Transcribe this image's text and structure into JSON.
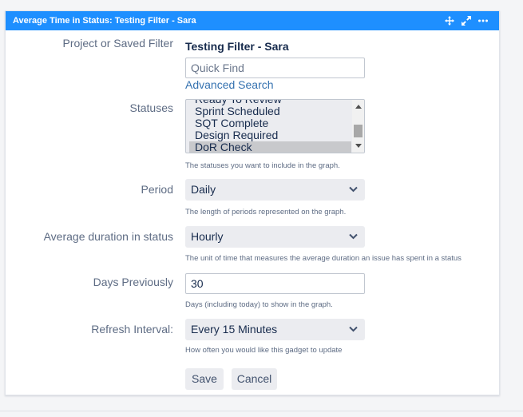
{
  "gadget": {
    "title": "Average Time in Status: Testing Filter - Sara",
    "icons": [
      "move-icon",
      "expand-icon",
      "more-icon"
    ]
  },
  "filter": {
    "label": "Project or Saved Filter",
    "value": "Testing Filter - Sara",
    "quick_find_placeholder": "Quick Find",
    "advanced_search": "Advanced Search"
  },
  "statuses": {
    "label": "Statuses",
    "options": [
      "Ready To Review",
      "Sprint Scheduled",
      "SQT Complete",
      "Design Required",
      "DoR Check"
    ],
    "selected": "DoR Check",
    "help": "The statuses you want to include in the graph."
  },
  "period": {
    "label": "Period",
    "value": "Daily",
    "help": "The length of periods represented on the graph."
  },
  "avg_duration": {
    "label": "Average duration in status",
    "value": "Hourly",
    "help": "The unit of time that measures the average duration an issue has spent in a status"
  },
  "days_previously": {
    "label": "Days Previously",
    "value": "30",
    "help": "Days (including today) to show in the graph."
  },
  "refresh": {
    "label": "Refresh Interval:",
    "value": "Every 15 Minutes",
    "help": "How often you would like this gadget to update"
  },
  "buttons": {
    "save": "Save",
    "cancel": "Cancel"
  },
  "colors": {
    "title_bar": "#1e8fff",
    "link": "#3572b0",
    "select_bg": "#ebecf0"
  }
}
